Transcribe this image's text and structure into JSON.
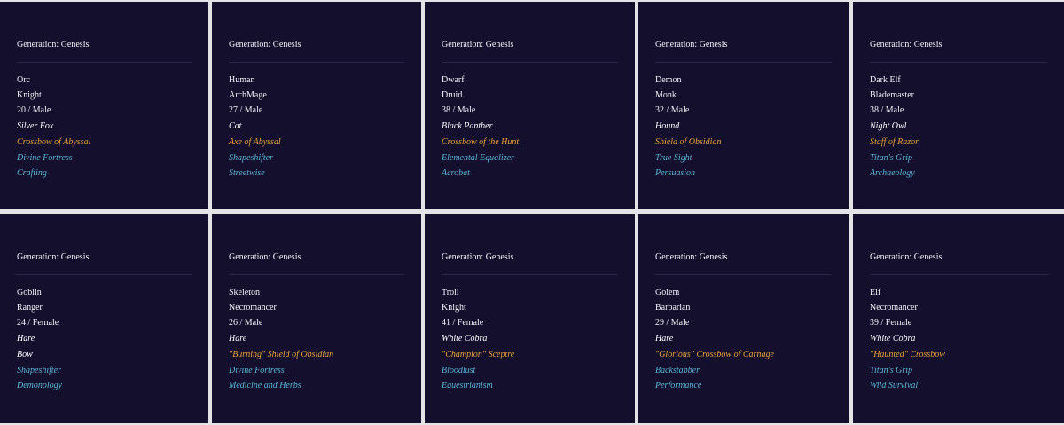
{
  "colors": {
    "card_bg": "#130f2c",
    "text": "#f2f2f7",
    "item_gold": "#e8a23a",
    "trait_blue": "#5bb6d8",
    "page_bg": "#e4e4e6"
  },
  "cards": [
    {
      "generation": "Generation: Genesis",
      "race": "Orc",
      "class": "Knight",
      "age_gender": "20 / Male",
      "pet": "Silver Fox",
      "weapon": "Crossbow of Abyssal",
      "weapon_style": "gold",
      "ability": "Divine Fortress",
      "skill": "Crafting"
    },
    {
      "generation": "Generation: Genesis",
      "race": "Human",
      "class": "ArchMage",
      "age_gender": "27 / Male",
      "pet": "Cat",
      "weapon": "Axe of Abyssal",
      "weapon_style": "gold",
      "ability": "Shapeshifter",
      "skill": "Streetwise"
    },
    {
      "generation": "Generation: Genesis",
      "race": "Dwarf",
      "class": "Druid",
      "age_gender": "38 / Male",
      "pet": "Black Panther",
      "weapon": "Crossbow of the Hunt",
      "weapon_style": "gold",
      "ability": "Elemental Equalizer",
      "skill": "Acrobat"
    },
    {
      "generation": "Generation: Genesis",
      "race": "Demon",
      "class": "Monk",
      "age_gender": "32 / Male",
      "pet": "Hound",
      "weapon": "Shield of Obsidian",
      "weapon_style": "gold",
      "ability": "True Sight",
      "skill": "Persuasion"
    },
    {
      "generation": "Generation: Genesis",
      "race": "Dark Elf",
      "class": "Blademaster",
      "age_gender": "38 / Male",
      "pet": "Night Owl",
      "weapon": "Staff of Razor",
      "weapon_style": "gold",
      "ability": "Titan's Grip",
      "skill": "Archaeology"
    },
    {
      "generation": "Generation: Genesis",
      "race": "Goblin",
      "class": "Ranger",
      "age_gender": "24 / Female",
      "pet": "Hare",
      "weapon": "Bow",
      "weapon_style": "plain",
      "ability": "Shapeshifter",
      "skill": "Demonology"
    },
    {
      "generation": "Generation: Genesis",
      "race": "Skeleton",
      "class": "Necromancer",
      "age_gender": "26 / Male",
      "pet": "Hare",
      "weapon": "\"Burning\" Shield of Obsidian",
      "weapon_style": "gold",
      "ability": "Divine Fortress",
      "skill": "Medicine and Herbs"
    },
    {
      "generation": "Generation: Genesis",
      "race": "Troll",
      "class": "Knight",
      "age_gender": "41 / Female",
      "pet": "White Cobra",
      "weapon": "\"Champion\" Sceptre",
      "weapon_style": "gold",
      "ability": "Bloodlust",
      "skill": "Equestrianism"
    },
    {
      "generation": "Generation: Genesis",
      "race": "Golem",
      "class": "Barbarian",
      "age_gender": "29 / Male",
      "pet": "Hare",
      "weapon": "\"Glorious\" Crossbow of Carnage",
      "weapon_style": "gold",
      "ability": "Backstabber",
      "skill": "Performance"
    },
    {
      "generation": "Generation: Genesis",
      "race": "Elf",
      "class": "Necromancer",
      "age_gender": "39 / Female",
      "pet": "White Cobra",
      "weapon": "\"Haunted\" Crossbow",
      "weapon_style": "gold",
      "ability": "Titan's Grip",
      "skill": "Wild Survival"
    }
  ]
}
